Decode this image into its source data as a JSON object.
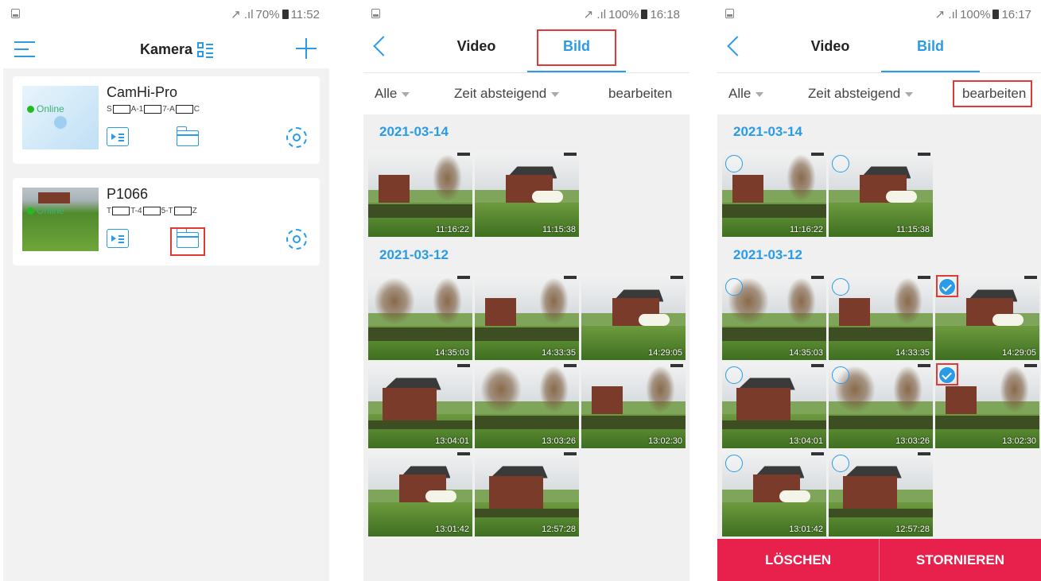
{
  "screen1": {
    "status": {
      "signal": "↗ .ıl",
      "battery": "70%",
      "time": "11:52"
    },
    "title": "Kamera",
    "cameras": [
      {
        "name": "CamHi-Pro",
        "status": "Online",
        "uid": [
          "S",
          "A-1",
          "7-A",
          "C"
        ]
      },
      {
        "name": "P1066",
        "status": "Online",
        "uid": [
          "T",
          "T-4",
          "5-T",
          "Z"
        ]
      }
    ],
    "icons": {
      "menu": "hamburger-menu-icon",
      "add": "plus-icon",
      "view": "grid-list-icon",
      "playback": "video-playlist-icon",
      "files": "folder-icon",
      "settings": "gear-icon"
    }
  },
  "screen2": {
    "status": {
      "signal": "↗ .ıl",
      "battery": "100%",
      "time": "16:18"
    },
    "tabs": [
      "Video",
      "Bild"
    ],
    "filters": {
      "all": "Alle",
      "sort": "Zeit absteigend",
      "edit": "bearbeiten"
    },
    "groups": [
      {
        "date": "2021-03-14",
        "photos": [
          "11:16:22",
          "11:15:38"
        ]
      },
      {
        "date": "2021-03-12",
        "photos": [
          "14:35:03",
          "14:33:35",
          "14:29:05",
          "13:04:01",
          "13:03:26",
          "13:02:30",
          "13:01:42",
          "12:57:28"
        ]
      }
    ]
  },
  "screen3": {
    "status": {
      "signal": "↗ .ıl",
      "battery": "100%",
      "time": "16:17"
    },
    "tabs": [
      "Video",
      "Bild"
    ],
    "filters": {
      "all": "Alle",
      "sort": "Zeit absteigend",
      "edit": "bearbeiten"
    },
    "groups": [
      {
        "date": "2021-03-14",
        "photos": [
          "11:16:22",
          "11:15:38"
        ]
      },
      {
        "date": "2021-03-12",
        "photos": [
          "14:35:03",
          "14:33:35",
          "14:29:05",
          "13:04:01",
          "13:03:26",
          "13:02:30",
          "13:01:42",
          "12:57:28"
        ]
      }
    ],
    "selected": [
      "14:29:05",
      "13:02:30"
    ],
    "actions": {
      "delete": "LÖSCHEN",
      "cancel": "STORNIEREN"
    }
  },
  "colors": {
    "accent": "#2a9be6",
    "danger": "#e8214c",
    "highlight": "#e53935",
    "online": "#22bb22"
  }
}
